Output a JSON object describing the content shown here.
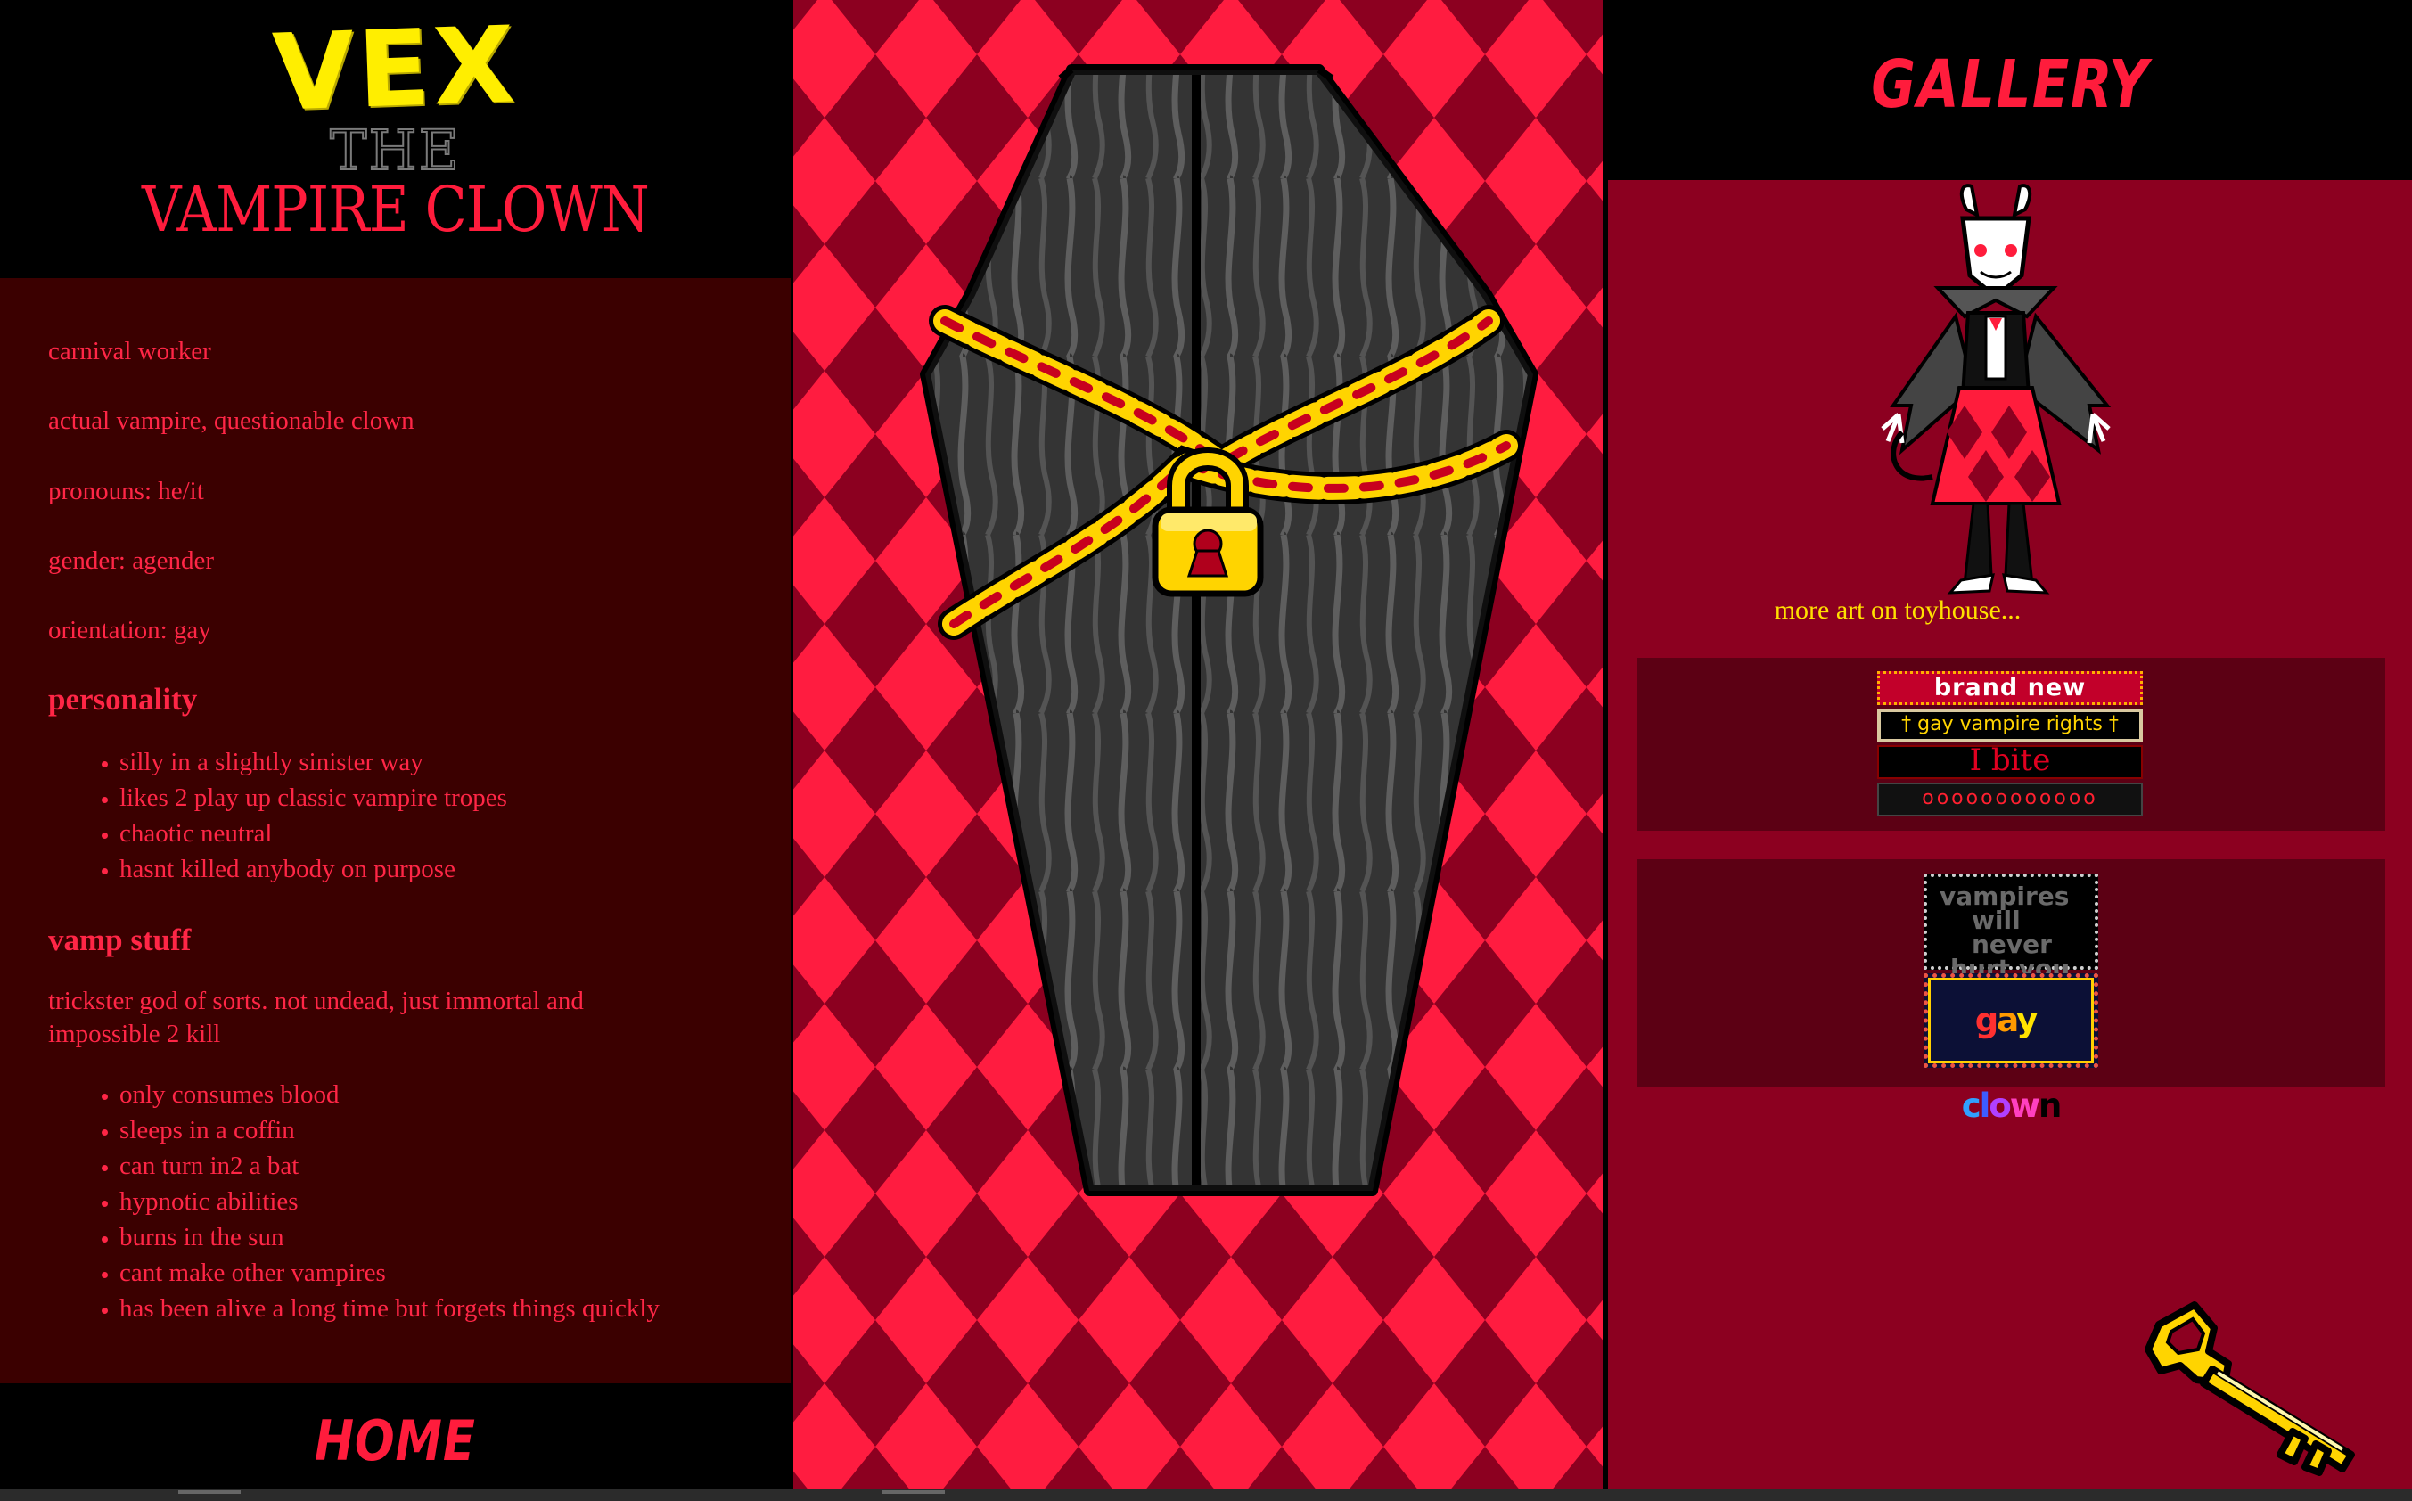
{
  "title": {
    "name": "VEX",
    "the": "THE",
    "subtitle": "VAMPIRE CLOWN"
  },
  "intro": [
    "carnival worker",
    "actual vampire, questionable clown",
    "pronouns: he/it",
    "gender: agender",
    "orientation: gay"
  ],
  "personality": {
    "heading": "personality",
    "items": [
      "silly in a slightly sinister way",
      "likes 2 play up classic vampire tropes",
      "chaotic neutral",
      "hasnt killed anybody on purpose"
    ]
  },
  "vamp_stuff": {
    "heading": "vamp stuff",
    "description": "trickster god of sorts. not undead, just immortal and impossible 2 kill",
    "items": [
      "only consumes blood",
      "sleeps in a coffin",
      "can turn in2 a bat",
      "hypnotic abilities",
      "burns in the sun",
      "cant make other vampires",
      "has been alive a long time but forgets things quickly"
    ]
  },
  "nav": {
    "home": "HOME",
    "gallery": "GALLERY"
  },
  "gallery": {
    "more_art": "more art on toyhouse..."
  },
  "blinkies": [
    "brand new species",
    "† gay vampire rights †",
    "I bite",
    "oooooooooooo"
  ],
  "stamps": {
    "vampires": [
      "vampires",
      "will never",
      "hurt you"
    ],
    "gay_clown": [
      "g",
      "a",
      "y",
      " ",
      "c",
      "l",
      "o",
      "w",
      "n"
    ]
  },
  "colors": {
    "accent_red": "#ff1c3c",
    "dark_red": "#8c0020",
    "maroon_panel": "#3b0000",
    "yellow": "#ffee00"
  },
  "icons": {
    "coffin": "coffin-icon",
    "padlock": "padlock-icon",
    "key": "key-icon"
  }
}
